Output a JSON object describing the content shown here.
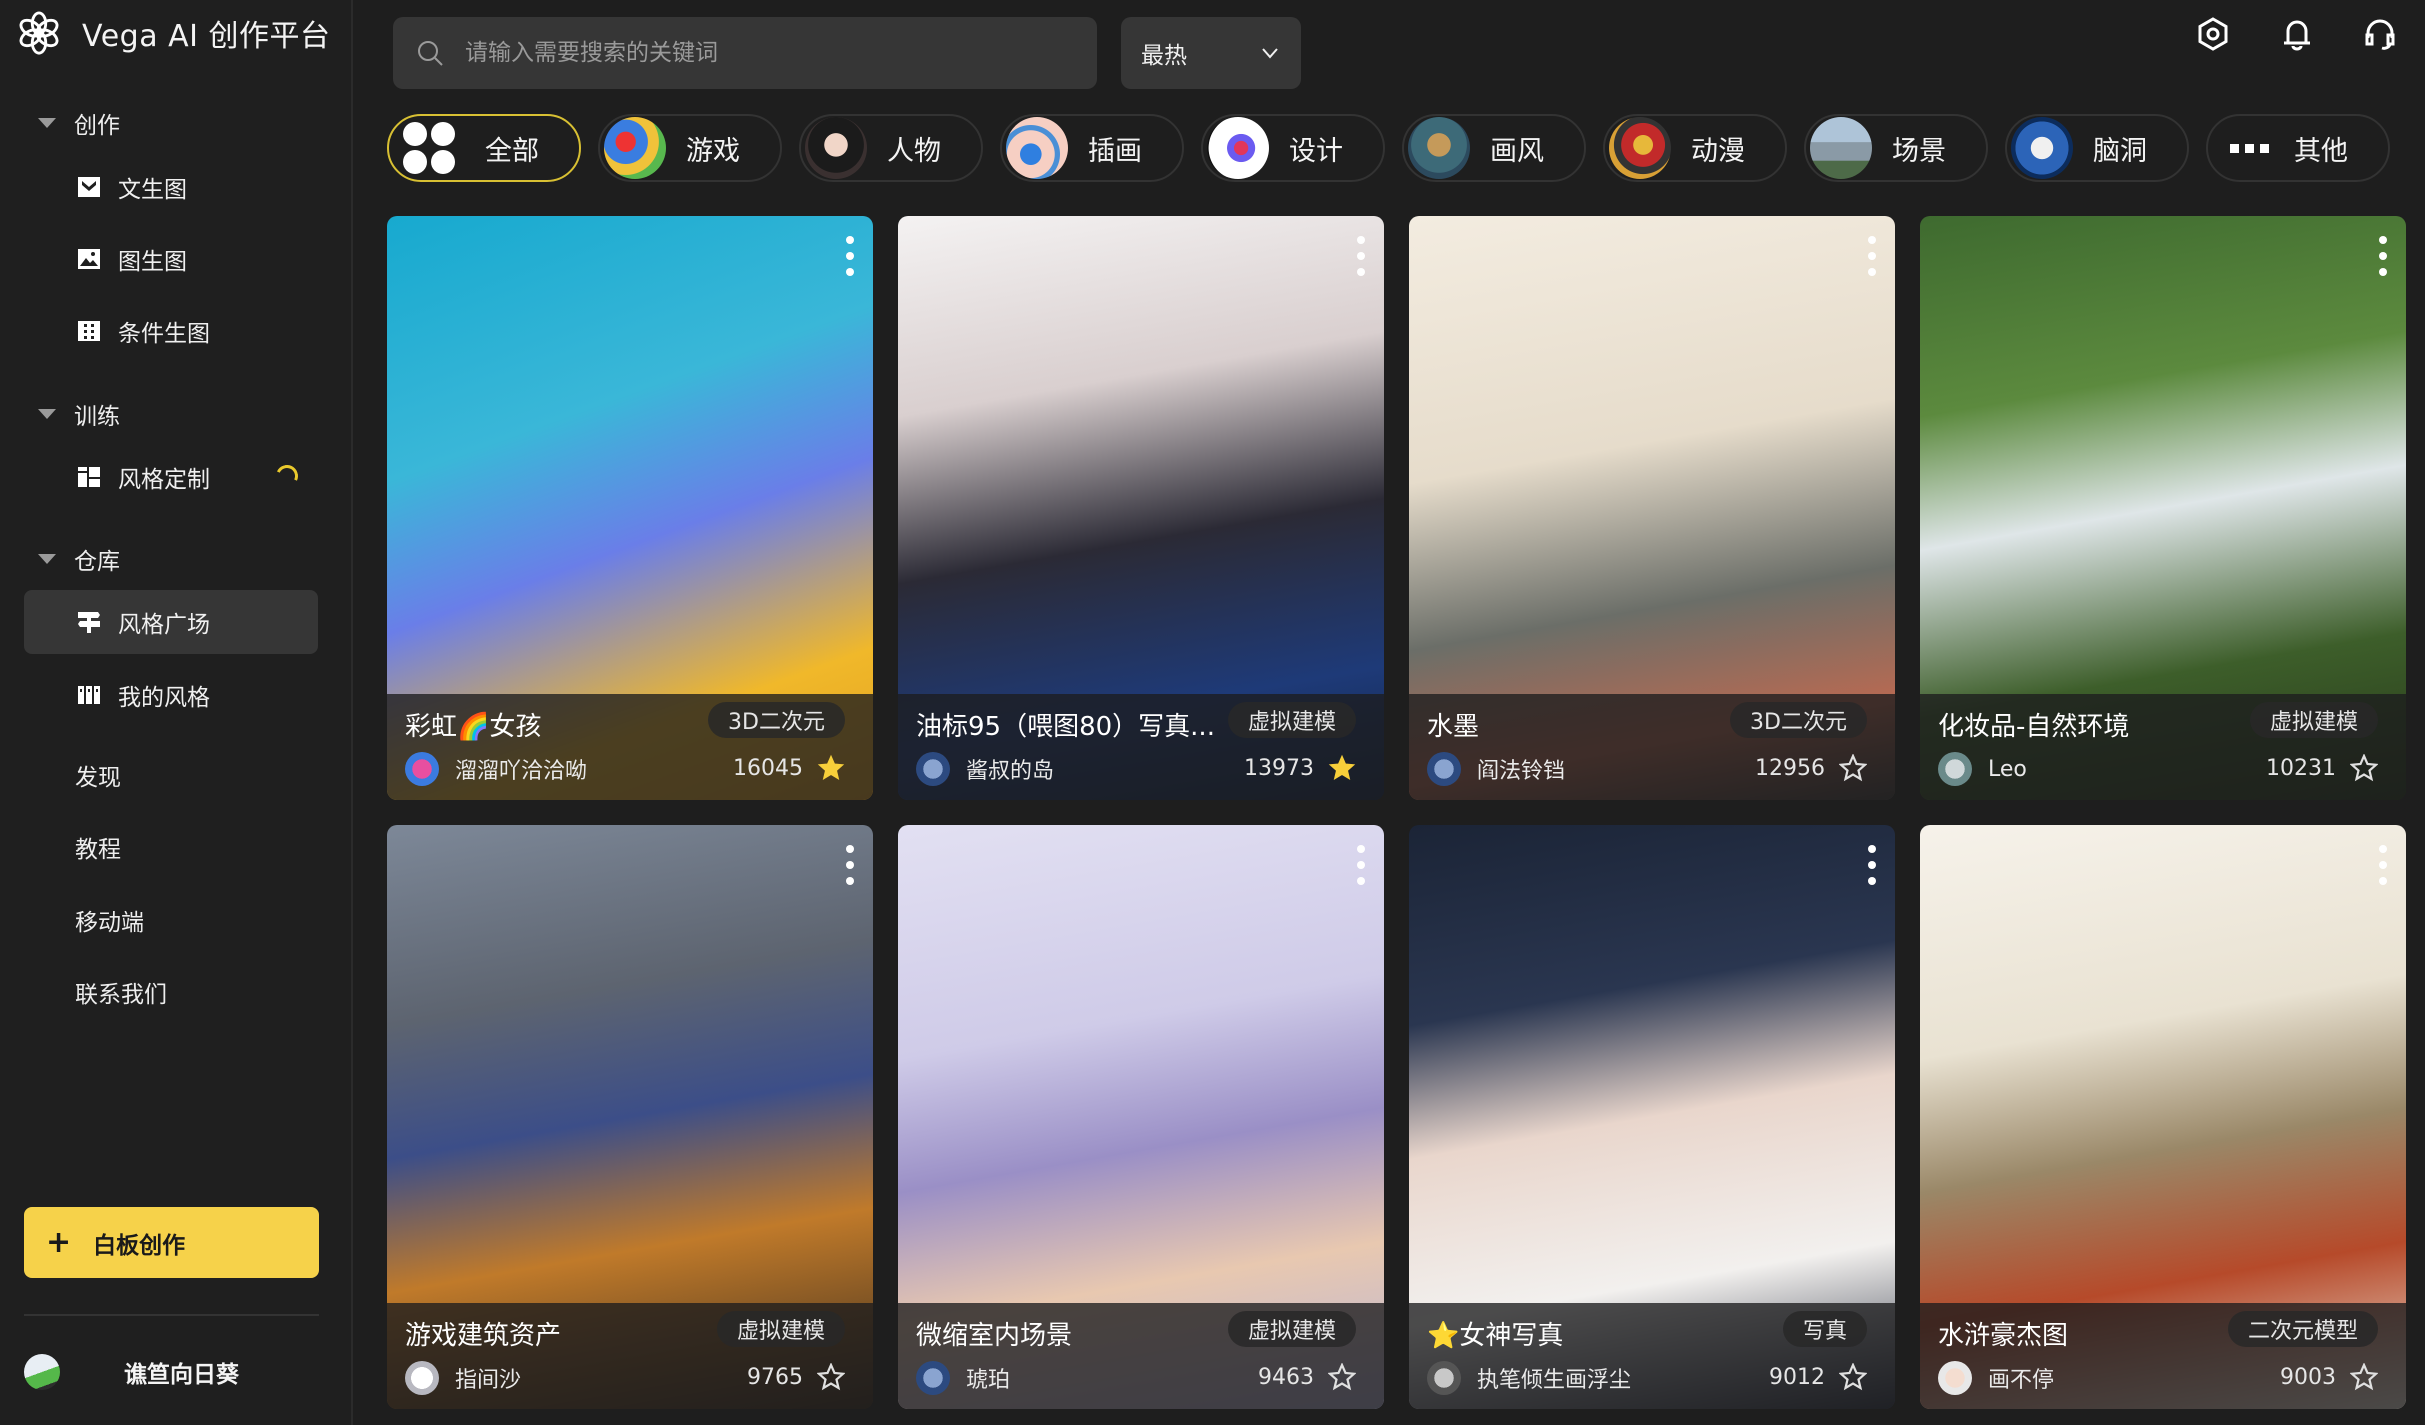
{
  "app": {
    "title": "Vega AI 创作平台"
  },
  "sidebar": {
    "groups": [
      {
        "label": "创作",
        "items": [
          {
            "label": "文生图",
            "icon": "text-to-image-icon"
          },
          {
            "label": "图生图",
            "icon": "image-to-image-icon"
          },
          {
            "label": "条件生图",
            "icon": "conditional-image-icon"
          }
        ]
      },
      {
        "label": "训练",
        "items": [
          {
            "label": "风格定制",
            "icon": "style-custom-icon",
            "status": "loading"
          }
        ]
      },
      {
        "label": "仓库",
        "items": [
          {
            "label": "风格广场",
            "icon": "style-plaza-icon",
            "active": true
          },
          {
            "label": "我的风格",
            "icon": "my-style-icon"
          }
        ]
      }
    ],
    "links": [
      "发现",
      "教程",
      "移动端",
      "联系我们"
    ],
    "create_button": "白板创作",
    "user": {
      "name": "谯笪向日葵"
    }
  },
  "topbar": {
    "search_placeholder": "请输入需要搜索的关键词",
    "search_value": "",
    "sort_selected": "最热",
    "icons": [
      "settings-icon",
      "bell-icon",
      "headset-icon"
    ]
  },
  "categories": [
    {
      "label": "全部",
      "active": true
    },
    {
      "label": "游戏"
    },
    {
      "label": "人物"
    },
    {
      "label": "插画"
    },
    {
      "label": "设计"
    },
    {
      "label": "画风"
    },
    {
      "label": "动漫"
    },
    {
      "label": "场景"
    },
    {
      "label": "脑洞"
    },
    {
      "label": "其他"
    }
  ],
  "cards": [
    {
      "title": "彩虹🌈女孩",
      "tag": "3D二次元",
      "author": "溜溜吖洽洽呦",
      "likes": "16045",
      "starred": true
    },
    {
      "title": "油标95（喂图80）写真...",
      "tag": "虚拟建模",
      "author": "酱叔的岛",
      "likes": "13973",
      "starred": true
    },
    {
      "title": "水墨",
      "tag": "3D二次元",
      "author": "阎法铃铛",
      "likes": "12956",
      "starred": false
    },
    {
      "title": "化妆品-自然环境",
      "tag": "虚拟建模",
      "author": "Leo",
      "likes": "10231",
      "starred": false
    },
    {
      "title": "游戏建筑资产",
      "tag": "虚拟建模",
      "author": "指间沙",
      "likes": "9765",
      "starred": false
    },
    {
      "title": "微缩室内场景",
      "tag": "虚拟建模",
      "author": "琥珀",
      "likes": "9463",
      "starred": false
    },
    {
      "title": "⭐女神写真",
      "tag": "写真",
      "author": "执笔倾生画浮尘",
      "likes": "9012",
      "starred": false
    },
    {
      "title": "水浒豪杰图",
      "tag": "二次元模型",
      "author": "画不停",
      "likes": "9003",
      "starred": false
    }
  ],
  "colors": {
    "accent": "#f6d24a",
    "star_active": "#f7cf3a",
    "background": "#1e1e1e"
  }
}
